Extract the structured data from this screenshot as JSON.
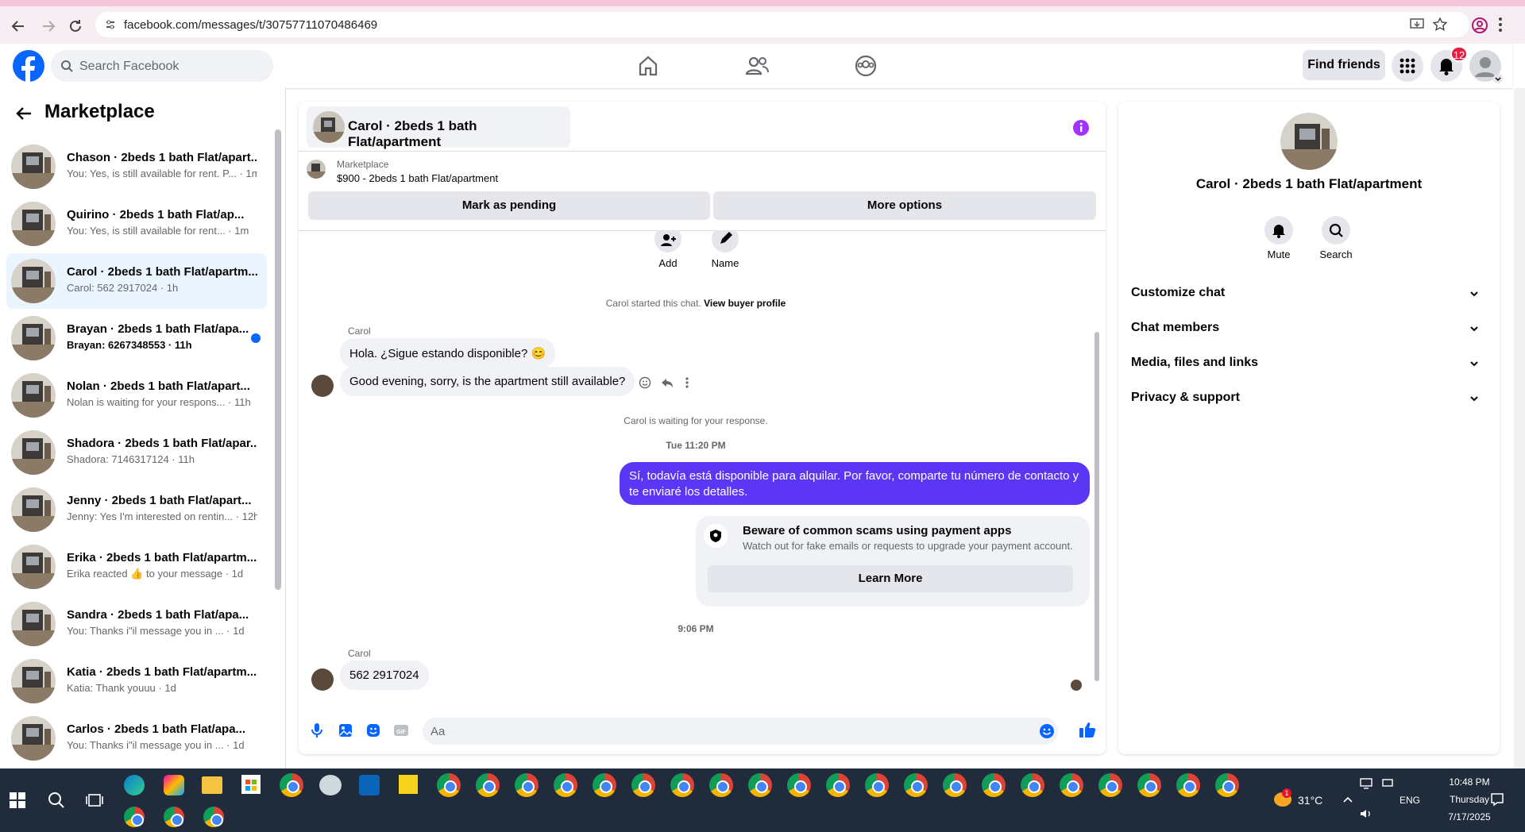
{
  "browser": {
    "url": "facebook.com/messages/t/30757711070486469"
  },
  "header": {
    "search_placeholder": "Search Facebook",
    "find_friends": "Find friends",
    "notif_count": "12"
  },
  "sidebar": {
    "title": "Marketplace",
    "conversations": [
      {
        "name": "Chason · 2beds 1 bath Flat/apart...",
        "preview": "You: Yes, is still available for rent. P... · 1m",
        "unread": false
      },
      {
        "name": "Quirino · 2beds 1 bath Flat/ap...",
        "preview": "You: Yes, is still available for rent... · 1m",
        "unread": false
      },
      {
        "name": "Carol · 2beds 1 bath Flat/apartm...",
        "preview": "Carol: 562 2917024 · 1h",
        "unread": false
      },
      {
        "name": "Brayan · 2beds 1 bath Flat/apa...",
        "preview": "Brayan: 6267348553 · 11h",
        "unread": true
      },
      {
        "name": "Nolan · 2beds 1 bath Flat/apart...",
        "preview": "Nolan is waiting for your respons... · 11h",
        "unread": false
      },
      {
        "name": "Shadora · 2beds 1 bath Flat/apar...",
        "preview": "Shadora: 7146317124 · 11h",
        "unread": false
      },
      {
        "name": "Jenny · 2beds 1 bath Flat/apart...",
        "preview": "Jenny: Yes I'm interested on rentin... · 12h",
        "unread": false
      },
      {
        "name": "Erika · 2beds 1 bath Flat/apartm...",
        "preview": "Erika reacted 👍 to your message · 1d",
        "unread": false
      },
      {
        "name": "Sandra · 2beds 1 bath Flat/apa...",
        "preview": "You: Thanks i\"il message you in ... · 1d",
        "unread": false
      },
      {
        "name": "Katia · 2beds 1 bath Flat/apartm...",
        "preview": "Katia: Thank youuu · 1d",
        "unread": false
      },
      {
        "name": "Carlos · 2beds 1 bath Flat/apa...",
        "preview": "You: Thanks i\"il message you in ... · 1d",
        "unread": false
      }
    ]
  },
  "chat": {
    "title": "Carol · 2beds 1 bath Flat/apartment",
    "marketplace_label": "Marketplace",
    "listing": "$900 - 2beds 1 bath Flat/apartment",
    "mark_pending": "Mark as pending",
    "more_options": "More options",
    "add_label": "Add",
    "name_label": "Name",
    "started_text": "Carol started this chat.",
    "view_buyer": "View buyer profile",
    "sender_name": "Carol",
    "msg1": "Hola. ¿Sigue estando disponible? 😊",
    "msg2": "Good evening, sorry, is the apartment still available?",
    "waiting": "Carol is waiting for your response.",
    "time1": "Tue 11:20 PM",
    "my_msg_line1": "Sí, todavía está disponible para alquilar. Por favor, comparte tu número de contacto y",
    "my_msg_line2": "te enviaré los detalles.",
    "scam_title": "Beware of common scams using payment apps",
    "scam_sub": "Watch out for fake emails or requests to upgrade your payment account.",
    "learn_more": "Learn More",
    "time2": "9:06 PM",
    "msg3": "562 2917024",
    "composer_placeholder": "Aa"
  },
  "panel": {
    "name": "Carol · 2beds 1 bath Flat/apartment",
    "mute": "Mute",
    "search": "Search",
    "sections": [
      "Customize chat",
      "Chat members",
      "Media, files and links",
      "Privacy & support"
    ]
  },
  "taskbar": {
    "temp": "31°C",
    "lang": "ENG",
    "time": "10:48 PM",
    "day": "Thursday",
    "date": "7/17/2025",
    "weather_badge": "1"
  },
  "colors": {
    "fb_blue": "#0866ff",
    "messenger_purple": "#5b36f5",
    "taskbar": "#202c3b"
  }
}
